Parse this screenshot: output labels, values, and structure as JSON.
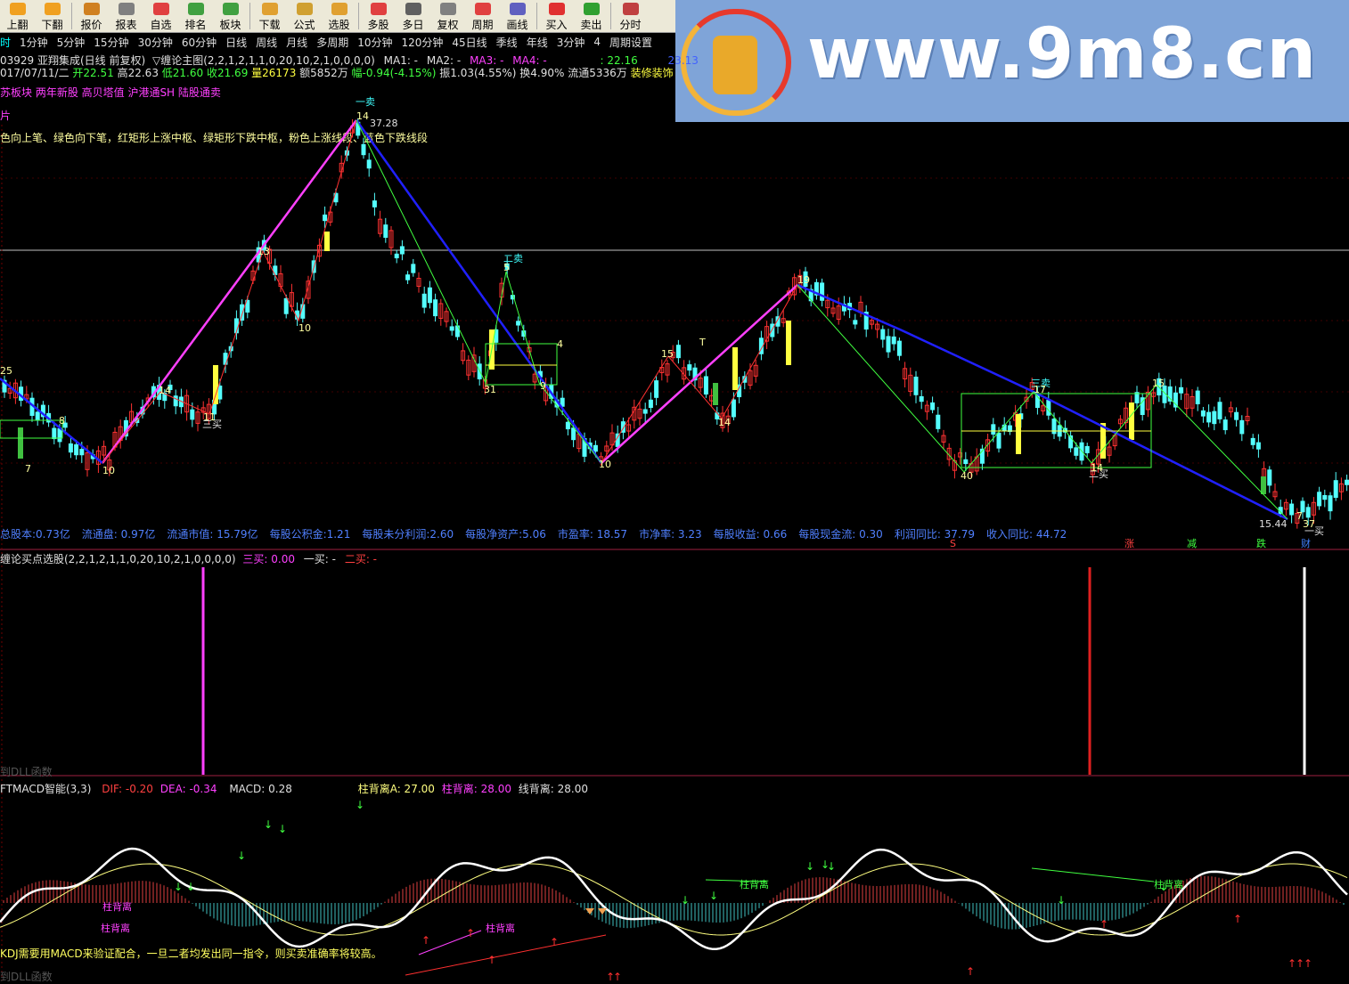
{
  "toolbar": {
    "buttons": [
      {
        "label": "上翻",
        "icon": "up-arrow-icon",
        "color": "#f0a020"
      },
      {
        "label": "下翻",
        "icon": "down-arrow-icon",
        "color": "#f0a020"
      },
      {
        "label": "报价",
        "icon": "price-icon",
        "color": "#d08020"
      },
      {
        "label": "报表",
        "icon": "report-icon",
        "color": "#808080"
      },
      {
        "label": "自选",
        "icon": "f6-icon",
        "color": "#e04040"
      },
      {
        "label": "排名",
        "icon": "rank-icon",
        "color": "#40a040"
      },
      {
        "label": "板块",
        "icon": "sector-icon",
        "color": "#40a040"
      },
      {
        "label": "下载",
        "icon": "download-icon",
        "color": "#e0a030"
      },
      {
        "label": "公式",
        "icon": "formula-icon",
        "color": "#d0a030"
      },
      {
        "label": "选股",
        "icon": "pick-icon",
        "color": "#e0a030"
      },
      {
        "label": "多股",
        "icon": "multi-icon",
        "color": "#e04040"
      },
      {
        "label": "多日",
        "icon": "clock-icon",
        "color": "#606060"
      },
      {
        "label": "复权",
        "icon": "restore-icon",
        "color": "#808080"
      },
      {
        "label": "周期",
        "icon": "f8-icon",
        "color": "#e04040"
      },
      {
        "label": "画线",
        "icon": "draw-icon",
        "color": "#6060c0"
      },
      {
        "label": "买入",
        "icon": "buy-icon",
        "color": "#e03030"
      },
      {
        "label": "卖出",
        "icon": "sell-icon",
        "color": "#30a030"
      },
      {
        "label": "分时",
        "icon": "minute-icon",
        "color": "#c04040"
      }
    ]
  },
  "periods": [
    "时",
    "1分钟",
    "5分钟",
    "15分钟",
    "30分钟",
    "60分钟",
    "日线",
    "周线",
    "月线",
    "多周期",
    "10分钟",
    "120分钟",
    "45日线",
    "季线",
    "年线",
    "3分钟",
    "4",
    "周期设置"
  ],
  "banner": {
    "url": "www.9m8.cn",
    "logo_text": "www.9m8.cn"
  },
  "header": {
    "line1": {
      "code": "03929 亚翔集成(日线 前复权)",
      "indicator": "▽缠论主图(2,2,1,2,1,1,0,20,10,2,1,0,0,0,0)",
      "ma1": "MA1: -",
      "ma2": "MA2: -",
      "ma3": "MA3: -",
      "ma4": "MA4: -",
      "v1": ": 22.16",
      "v2": "23.13"
    },
    "line2": {
      "date": "017/07/11/二",
      "open": "开22.51",
      "high": "高22.63",
      "low": "低21.60",
      "close": "收21.69",
      "vol": "量26173",
      "amt": "额5852万",
      "chg": "幅-0.94(-4.15%)",
      "amp": "振1.03(4.55%)",
      "turn": "换4.90%",
      "flow": "流通5336万",
      "sector": "装修装饰"
    },
    "line3": "苏板块 两年新股 高贝塔值 沪港通SH 陆股通卖",
    "line4": "片",
    "line5": "色向上笔、绿色向下笔，红矩形上涨中枢、绿矩形下跌中枢，粉色上涨线段、蓝色下跌线段"
  },
  "fund_bar": {
    "items": [
      "总股本:0.73亿",
      "流通盘: 0.97亿",
      "流通市值: 15.79亿",
      "每股公积金:1.21",
      "每股未分利润:2.60",
      "每股净资产:5.06",
      "市盈率: 18.57",
      "市净率: 3.23",
      "每股收益: 0.66",
      "每股现金流: 0.30",
      "利润同比: 37.79",
      "收入同比: 44.72"
    ],
    "markers": [
      {
        "t": "S",
        "c": "#ff4040"
      },
      {
        "t": "涨",
        "c": "#ff4040"
      },
      {
        "t": "减",
        "c": "#40ff40"
      },
      {
        "t": "跌",
        "c": "#40ff40"
      },
      {
        "t": "财",
        "c": "#4080ff"
      }
    ]
  },
  "main_labels": {
    "sell1": "一卖",
    "sell2": "二卖",
    "sell3": "三卖",
    "buy1": "一买",
    "buy2": "二买",
    "buy3": "三买",
    "peak": "37.28",
    "trough": "15.44",
    "pivots": [
      "25",
      "7",
      "10",
      "14",
      "11",
      "13",
      "10",
      "14",
      "5",
      "31",
      "9",
      "4",
      "10",
      "15",
      "14",
      "19",
      "40",
      "17",
      "14",
      "15",
      "37",
      "8",
      "T",
      "7"
    ]
  },
  "buy_panel": {
    "title": "缠论买点选股(2,2,1,2,1,1,0,20,10,2,1,0,0,0,0)",
    "b3": "三买: 0.00",
    "b1": "一买: -",
    "b2": "二买: -",
    "footer": "到DLL函数"
  },
  "macd_panel": {
    "title": "FTMACD智能(3,3)",
    "dif": "DIF: -0.20",
    "dea": "DEA: -0.34",
    "macd": "MACD: 0.28",
    "zba": "柱背离A: 27.00",
    "zb": "柱背离: 28.00",
    "xb": "线背离: 28.00",
    "tag_zbl": "柱背离",
    "tag_xbl": "线背离",
    "note": "KDJ需要用MACD来验证配合，一旦二者均发出同一指令，则买卖准确率将较高。",
    "footer": "到DLL函数"
  },
  "colors": {
    "up": "#ff3232",
    "down": "#54ffff",
    "pink": "#ff40ff",
    "blue": "#2020ff",
    "yellow": "#ffff40",
    "green": "#40ff40"
  }
}
